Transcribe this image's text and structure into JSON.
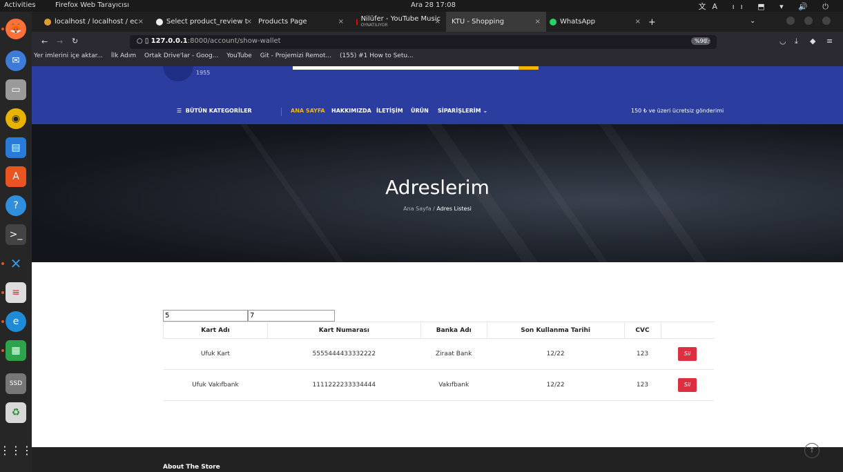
{
  "system": {
    "activities": "Activities",
    "app_name": "Firefox Web Tarayıcısı",
    "clock": "Ara 28 17:08",
    "tray": "文A ıı ⬒ ▾ 🔊 ⏻"
  },
  "dock": {
    "items": [
      "firefox-icon",
      "thunderbird-icon",
      "files-icon",
      "rhythmbox-icon",
      "writer-icon",
      "software-icon",
      "help-icon",
      "terminal-icon",
      "vscode-icon",
      "text-editor-icon",
      "edge-icon",
      "calc-icon",
      "drive-icon",
      "trash-icon",
      "apps-grid-icon"
    ]
  },
  "browser": {
    "tabs": [
      {
        "label": "localhost / localhost / ec",
        "active": false
      },
      {
        "label": "Select product_review t",
        "active": false
      },
      {
        "label": "Products Page",
        "active": false
      },
      {
        "label": "Nilüfer - YouTube Music",
        "sub": "OYNATILIYOR",
        "active": false
      },
      {
        "label": "KTU - Shopping",
        "active": true
      },
      {
        "label": "WhatsApp",
        "active": false
      }
    ],
    "url_host": "127.0.0.1",
    "url_rest": ":8000/account/show-wallet",
    "zoom": "%90",
    "bookmarks": [
      "Yer imlerini içe aktar...",
      "İlk Adım",
      "Ortak Drive'lar - Goog...",
      "YouTube",
      "Git - Projemizi Remot...",
      "(155) #1 How to Setu..."
    ]
  },
  "site": {
    "logo_year": "1955",
    "nav": {
      "categories": "BÜTÜN KATEGORİLER",
      "home": "ANA SAYFA",
      "about": "HAKKIMIZDA",
      "contact": "İLETİŞİM",
      "product": "ÜRÜN",
      "orders": "SİPARİŞLERİM",
      "shipping_note": "150 ₺ ve üzeri ücretsiz gönderimi"
    },
    "hero": {
      "title": "Adreslerim",
      "crumb_home": "Ana Sayfa",
      "crumb_sep": " / ",
      "crumb_current": "Adres Listesi"
    },
    "inputs": {
      "first": "5",
      "second": "7"
    },
    "table": {
      "headers": [
        "Kart Adı",
        "Kart Numarası",
        "Banka Adı",
        "Son Kullanma Tarihi",
        "CVC"
      ],
      "rows": [
        [
          "Ufuk Kart",
          "5555444433332222",
          "Ziraat Bank",
          "12/22",
          "123"
        ],
        [
          "Ufuk Vakıfbank",
          "1111222233334444",
          "Vakıfbank",
          "12/22",
          "123"
        ]
      ],
      "delete_label": "Sil"
    },
    "footer": {
      "about": "About The Store"
    }
  }
}
